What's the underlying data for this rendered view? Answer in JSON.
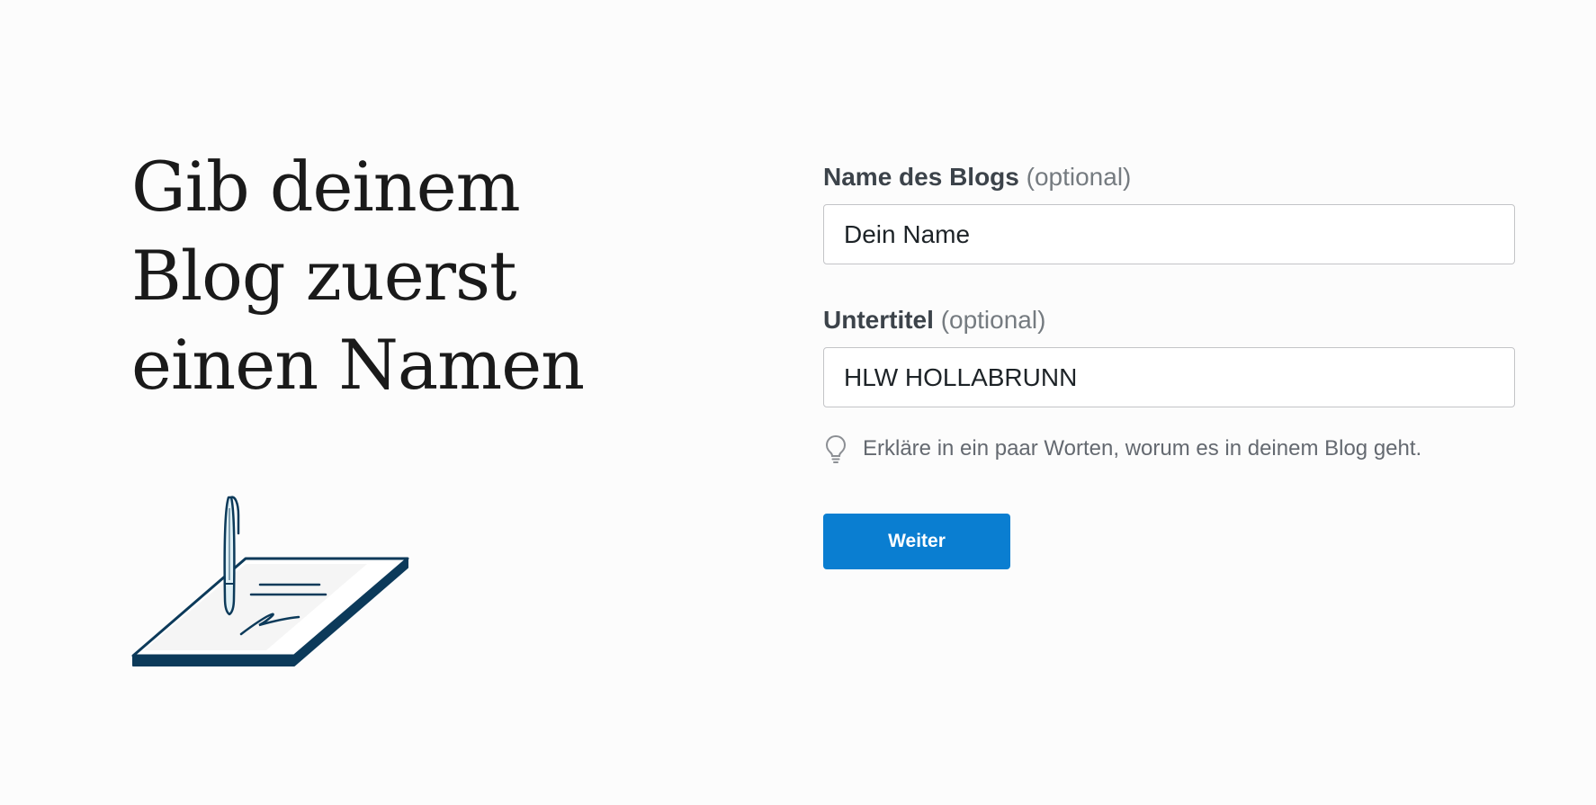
{
  "heading": {
    "line1": "Gib deinem",
    "line2": "Blog zuerst",
    "line3": "einen Namen"
  },
  "illustration": {
    "icon": "pen-writing-on-notepad-illustration"
  },
  "form": {
    "blog_name": {
      "label": "Name des Blogs",
      "optional_suffix": "(optional)",
      "value": "Dein Name"
    },
    "subtitle": {
      "label": "Untertitel",
      "optional_suffix": "(optional)",
      "value": "HLW HOLLABRUNN"
    },
    "hint": {
      "icon": "lightbulb-icon",
      "text": "Erkläre in ein paar Worten, worum es in deinem Blog geht."
    },
    "submit_label": "Weiter"
  },
  "colors": {
    "accent": "#0a7ed1",
    "illustration_stroke": "#0c3a5a",
    "background": "#fcfcfc"
  }
}
